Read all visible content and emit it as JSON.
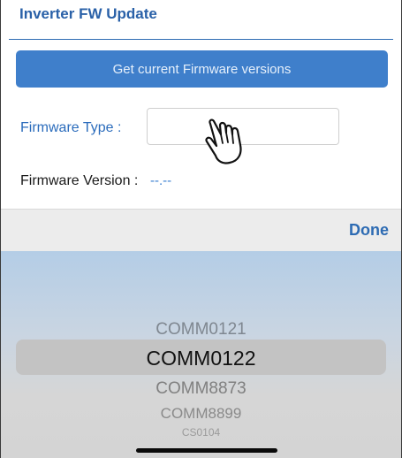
{
  "header": {
    "title": "Inverter FW Update"
  },
  "actions": {
    "get_versions_label": "Get current Firmware versions"
  },
  "firmware_type": {
    "label": "Firmware Type :",
    "value": ""
  },
  "firmware_version": {
    "label": "Firmware Version :",
    "value": "--.--"
  },
  "accessory": {
    "done_label": "Done"
  },
  "picker": {
    "selected": "COMM0122",
    "items": [
      "COMM0121",
      "COMM0122",
      "COMM8873",
      "COMM8899",
      "CS0104"
    ]
  },
  "colors": {
    "accent": "#3f7fcb",
    "label_blue": "#2b6cbc"
  }
}
